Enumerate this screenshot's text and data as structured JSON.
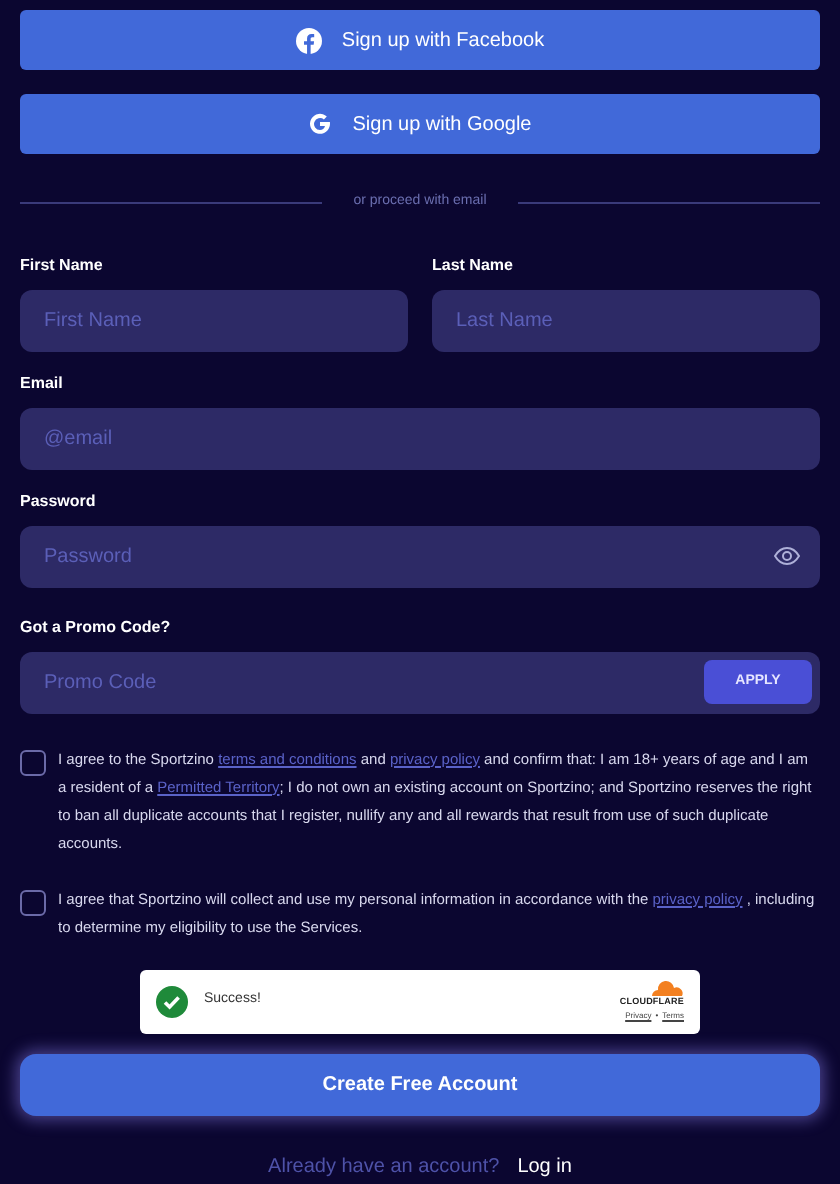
{
  "social_buttons": [
    {
      "kind": "facebook",
      "label": "Sign up with Facebook"
    },
    {
      "kind": "google",
      "label": "Sign up with Google"
    }
  ],
  "divider": "or proceed with email",
  "fields": [
    {
      "label": "First Name",
      "placeholder": "First Name"
    },
    {
      "label": "Last Name",
      "placeholder": "Last Name"
    },
    {
      "label": "Email",
      "placeholder": "@email"
    },
    {
      "label": "Password",
      "placeholder": "Password",
      "kind": "password"
    }
  ],
  "promo": {
    "label": "Got a Promo Code?",
    "placeholder": "Promo Code",
    "button": "APPLY"
  },
  "consents": [
    {
      "checked": false,
      "parts": [
        {
          "kind": "text",
          "text": "I agree to the Sportzino "
        },
        {
          "kind": "link",
          "text": "terms and conditions"
        },
        {
          "kind": "text",
          "text": " and "
        },
        {
          "kind": "link",
          "text": "privacy policy"
        },
        {
          "kind": "text",
          "text": " and confirm that: I am 18+ years of age and I am a resident of a "
        },
        {
          "kind": "link",
          "text": "Permitted Territory"
        },
        {
          "kind": "text",
          "text": "; I do not own an existing account on Sportzino; and Sportzino reserves the right to ban all duplicate accounts that I register, nullify any and all rewards that result from use of such duplicate accounts."
        }
      ]
    },
    {
      "checked": false,
      "parts": [
        {
          "kind": "text",
          "text": "I agree that Sportzino will collect and use my personal information in accordance with the "
        },
        {
          "kind": "link",
          "text": "privacy policy"
        },
        {
          "kind": "text",
          "text": " , including to determine my eligibility to use the Services."
        }
      ]
    }
  ],
  "captcha": {
    "status": "Success!",
    "brand": "CLOUDFLARE",
    "privacy": "Privacy",
    "separator": "•",
    "terms": "Terms"
  },
  "submit": "Create Free Account",
  "login": {
    "prompt": "Already have an account?",
    "link": "Log in"
  }
}
